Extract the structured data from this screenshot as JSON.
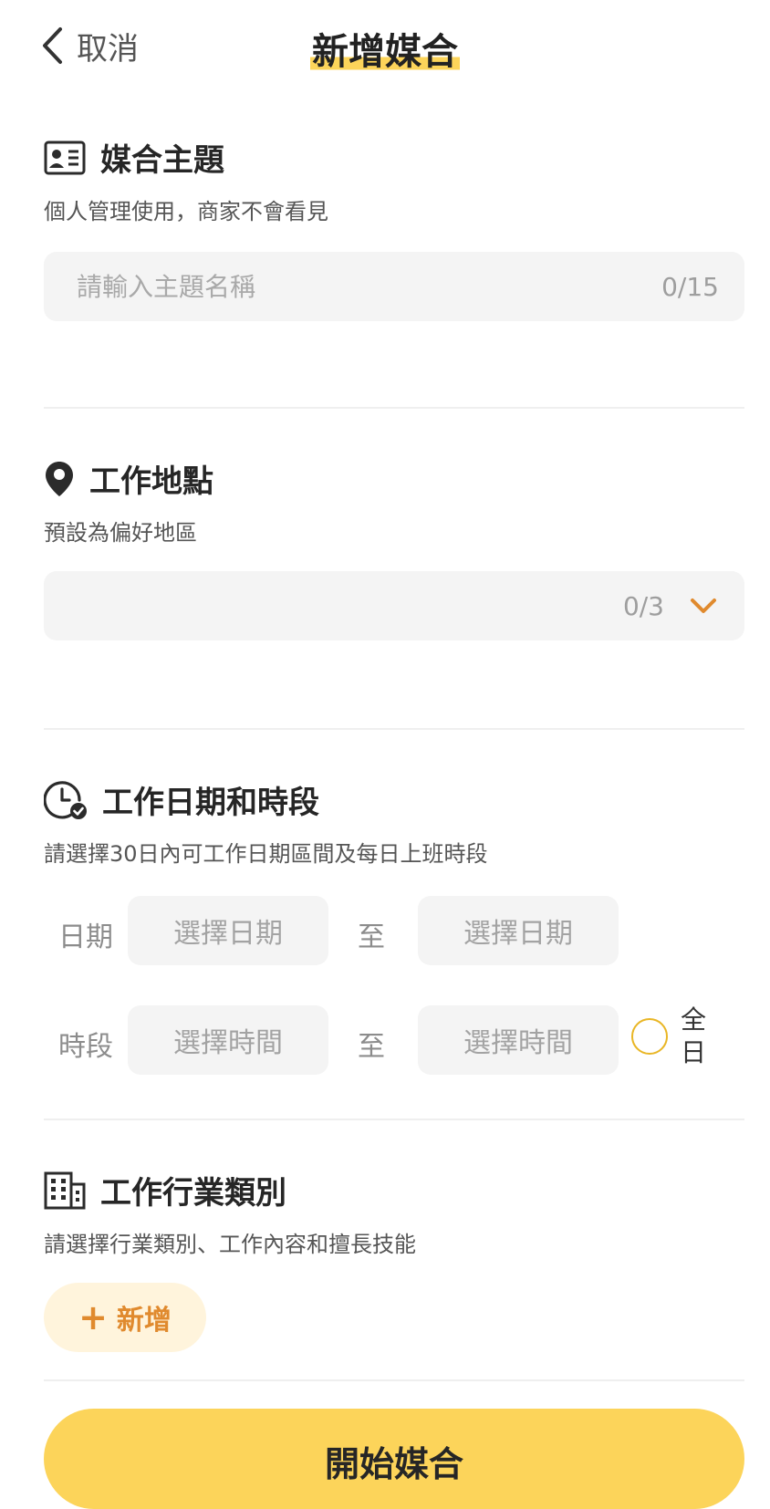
{
  "header": {
    "back_label": "取消",
    "title": "新增媒合"
  },
  "topic": {
    "title": "媒合主題",
    "subtitle": "個人管理使用，商家不會看見",
    "placeholder": "請輸入主題名稱",
    "value": "",
    "counter": "0/15",
    "icon": "id-card-icon"
  },
  "location": {
    "title": "工作地點",
    "subtitle": "預設為偏好地區",
    "counter": "0/3",
    "icon": "location-pin-icon"
  },
  "schedule": {
    "title": "工作日期和時段",
    "subtitle": "請選擇30日內可工作日期區間及每日上班時段",
    "date_label": "日期",
    "date_start": "選擇日期",
    "date_end": "選擇日期",
    "to_label": "至",
    "time_label": "時段",
    "time_start": "選擇時間",
    "time_end": "選擇時間",
    "all_day_label": "全日",
    "all_day_checked": false,
    "icon": "clock-check-icon"
  },
  "industry": {
    "title": "工作行業類別",
    "subtitle": "請選擇行業類別、工作內容和擅長技能",
    "add_label": "新增",
    "icon": "building-icon"
  },
  "submit_label": "開始媒合",
  "colors": {
    "accent": "#fcd45a",
    "orange": "#e08a2e",
    "field_bg": "#f4f4f4",
    "radio_border": "#e9b625"
  }
}
